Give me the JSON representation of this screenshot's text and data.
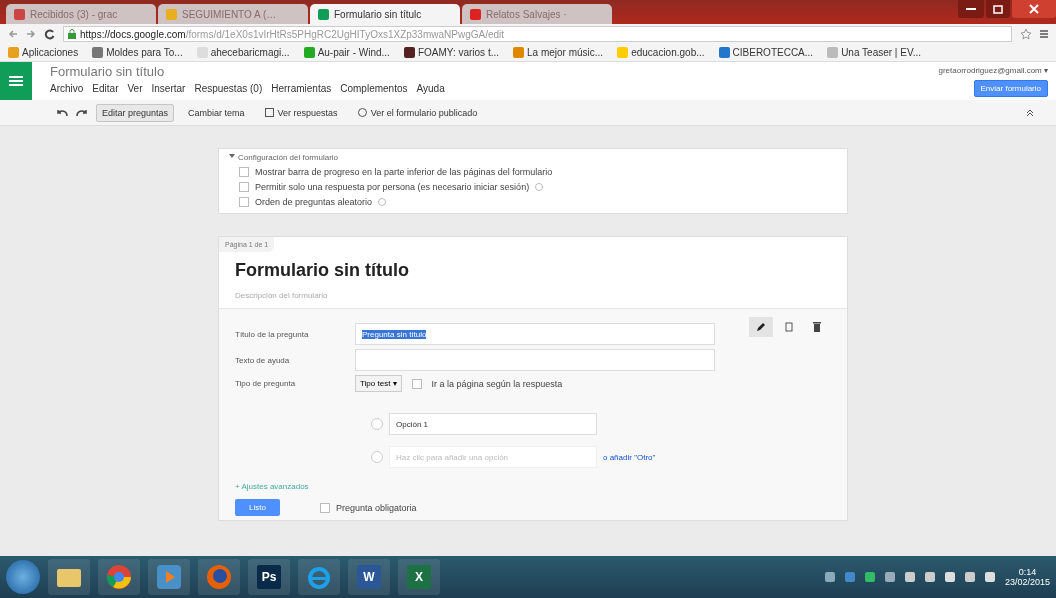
{
  "browser": {
    "tabs": [
      {
        "title": "Recibidos (3) - grac",
        "kind": "mail",
        "selected": false
      },
      {
        "title": "SEGUIMIENTO A (…",
        "kind": "drive",
        "selected": false
      },
      {
        "title": "Formulario sin títulc",
        "kind": "forms",
        "selected": true
      },
      {
        "title": "Relatos Salvajes ·",
        "kind": "video",
        "selected": false
      }
    ],
    "url_host": "https://docs.google.com",
    "url_path": "/forms/d/1eX0s1vIrHtRs5PHgRC2UgHITyOxs1XZp33mwaNPwgGA/edit",
    "bookmarks": [
      "Aplicaciones",
      "Moldes para To...",
      "ahecebaricmagi...",
      "Au-pair - Wind...",
      "FOAMY: varios t...",
      "La mejor músic...",
      "educacion.gob...",
      "CIBEROTECCA...",
      "Una Teaser | EV..."
    ]
  },
  "app": {
    "title": "Formulario sin título",
    "account": "gretaorrodriguez@gmail.com ▾",
    "send_button": "Enviar formulario",
    "menu": [
      "Archivo",
      "Editar",
      "Ver",
      "Insertar",
      "Respuestas (0)",
      "Herramientas",
      "Complementos",
      "Ayuda"
    ],
    "toolbar": [
      {
        "label": "Editar preguntas",
        "selected": true
      },
      {
        "label": "Cambiar tema",
        "selected": false
      },
      {
        "label": "Ver respuestas",
        "selected": false
      },
      {
        "label": "Ver el formulario publicado",
        "selected": false
      }
    ]
  },
  "settings": {
    "title": "Configuración del formulario",
    "expanded": true,
    "options": [
      {
        "label": "Mostrar barra de progreso en la parte inferior de las páginas del formulario",
        "checked": false,
        "help": false
      },
      {
        "label": "Permitir solo una respuesta por persona (es necesario iniciar sesión)",
        "checked": false,
        "help": true
      },
      {
        "label": "Orden de preguntas aleatorio",
        "checked": false,
        "help": true
      }
    ]
  },
  "page": {
    "label": "Página 1 de 1",
    "title": "Formulario sin título",
    "description_placeholder": "Descripción del formulario"
  },
  "question": {
    "title_label": "Título de la pregunta",
    "title_value": "Pregunta sin título",
    "help_label": "Texto de ayuda",
    "type_label": "Tipo de pregunta",
    "type_value": "Tipo test ▾",
    "go_to_page": {
      "label": "Ir a la página según la respuesta",
      "checked": false
    },
    "options": [
      "Opción 1"
    ],
    "add_option_placeholder": "Haz clic para añadir una opción",
    "add_other": "o añadir \"Otro\"",
    "advanced": "+ Ajustes avanzados",
    "done": "Listo",
    "required": {
      "label": "Pregunta obligatoria",
      "checked": false
    }
  },
  "taskbar": {
    "apps": [
      {
        "kind": "folder"
      },
      {
        "kind": "chrome"
      },
      {
        "kind": "media"
      },
      {
        "kind": "firefox"
      },
      {
        "kind": "letter",
        "label": "Ps",
        "color": "#0a2a4a"
      },
      {
        "kind": "ie"
      },
      {
        "kind": "letter",
        "label": "W",
        "color": "#2b5797"
      },
      {
        "kind": "letter",
        "label": "X",
        "color": "#1e7145"
      }
    ],
    "time": "0:14",
    "date": "23/02/2015"
  }
}
